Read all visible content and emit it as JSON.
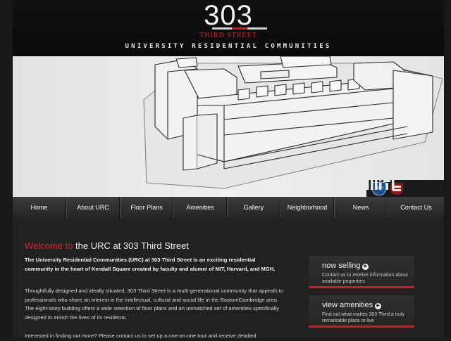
{
  "brand": {
    "number": "303",
    "street": "THIRD STREET",
    "tagline": "UNIVERSITY RESIDENTIAL COMMUNITIES"
  },
  "partners": {
    "mgh_label": "MGH",
    "mit_label": "MIT"
  },
  "nav": [
    {
      "label": "Home"
    },
    {
      "label": "About URC"
    },
    {
      "label": "Floor Plans"
    },
    {
      "label": "Amenities"
    },
    {
      "label": "Gallery"
    },
    {
      "label": "Neighborhood"
    },
    {
      "label": "News"
    },
    {
      "label": "Contact Us"
    }
  ],
  "main": {
    "title_accent": "Welcome to",
    "title_rest": " the URC at 303 Third Street",
    "intro": "The University Residential Communities (URC) at 303 Third Street is an exciting residential community in the heart of Kendall Square created by faculty and alumni of MIT, Harvard, and MGH.",
    "body": "Thoughtfully designed and ideally situated, 303 Third Street is a multi-generational community that appeals to professionals who share an interest in the intellectual, cultural and social life in the Boston/Cambridge area. The eight-story building offers a wide selection of floor plans and an unmatched set of amenities specifically designed to enrich the lives of its residents.",
    "body2": "Interested in finding out more? Please contact us to set up a one-on-one tour and receive detailed"
  },
  "sidebar": {
    "cards": [
      {
        "title": "now selling",
        "desc": "Contact us to receive information about available properties"
      },
      {
        "title": "view amenities",
        "desc": "Find out what makes 303 Third a truly remarkable place to live"
      }
    ]
  },
  "colors": {
    "accent": "#d42a37",
    "background": "#1f2020",
    "hero": "#e8e7e9",
    "nav": "#2e2f2f"
  }
}
